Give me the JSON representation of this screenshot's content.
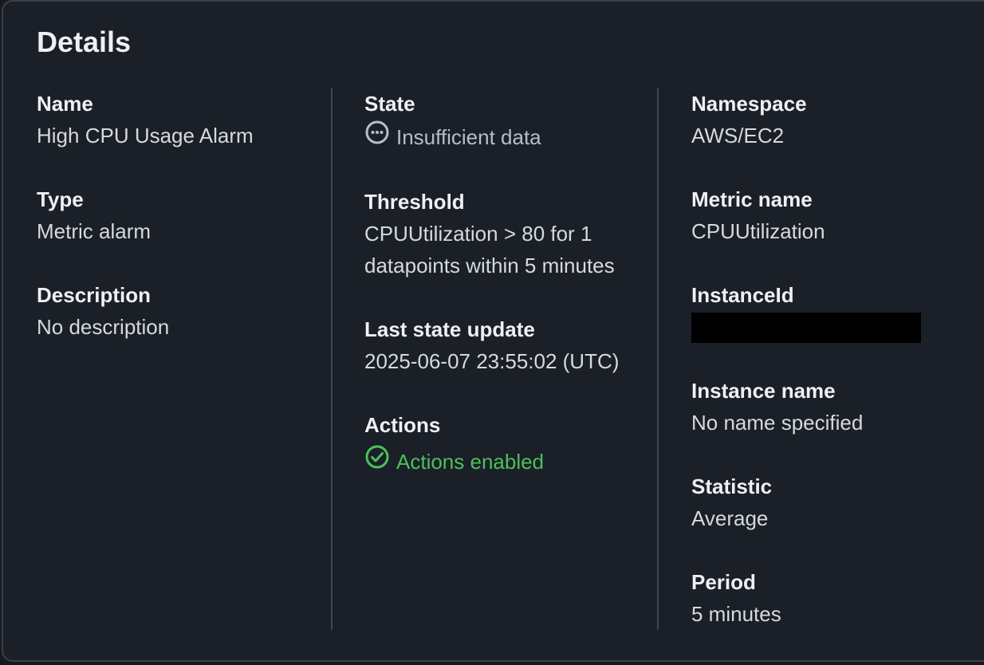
{
  "panel": {
    "title": "Details"
  },
  "fields": {
    "name": {
      "label": "Name",
      "value": "High CPU Usage Alarm"
    },
    "type": {
      "label": "Type",
      "value": "Metric alarm"
    },
    "description": {
      "label": "Description",
      "value": "No description"
    },
    "state": {
      "label": "State",
      "value": "Insufficient data",
      "icon": "ellipsis-circle-icon",
      "color": "#b6bec9"
    },
    "threshold": {
      "label": "Threshold",
      "value": "CPUUtilization > 80 for 1 datapoints within 5 minutes"
    },
    "last_state_update": {
      "label": "Last state update",
      "value": "2025-06-07 23:55:02 (UTC)"
    },
    "actions": {
      "label": "Actions",
      "value": "Actions enabled",
      "icon": "check-circle-icon",
      "color": "#4cc05a"
    },
    "namespace": {
      "label": "Namespace",
      "value": "AWS/EC2"
    },
    "metric_name": {
      "label": "Metric name",
      "value": "CPUUtilization"
    },
    "instance_id": {
      "label": "InstanceId",
      "value_redacted": true
    },
    "instance_name": {
      "label": "Instance name",
      "value": "No name specified"
    },
    "statistic": {
      "label": "Statistic",
      "value": "Average"
    },
    "period": {
      "label": "Period",
      "value": "5 minutes"
    }
  }
}
